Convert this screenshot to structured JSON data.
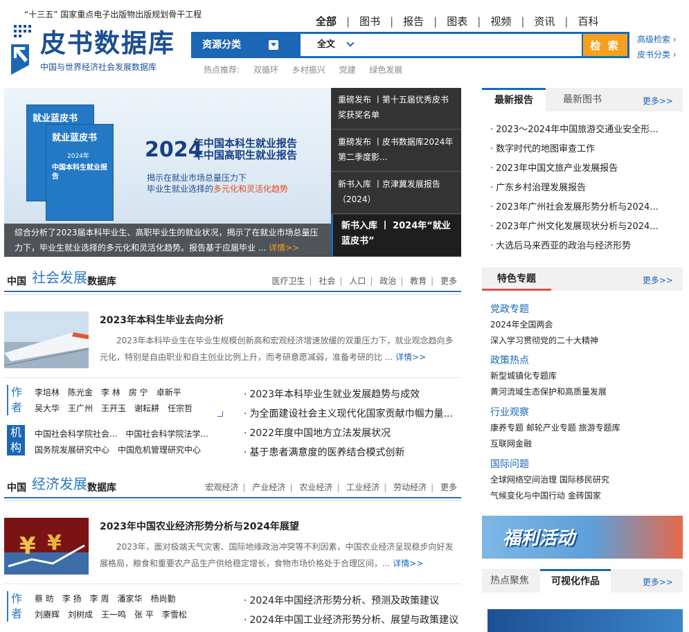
{
  "header": {
    "tagline": "“十三五” 国家重点电子出版物出版规划骨干工程",
    "logo_title": "皮书数据库",
    "logo_sub": "中国与世界经济社会发展数据库",
    "nav": [
      "全部",
      "图书",
      "报告",
      "图表",
      "视频",
      "资讯",
      "百科"
    ],
    "active_nav": "全部"
  },
  "search": {
    "category_label": "资源分类",
    "scope": "全文",
    "placeholder": "",
    "button": "检 索",
    "advanced": "高级检索 ›",
    "classified": "皮书分类 ›",
    "hot_label": "热点推荐:",
    "hot_items": [
      "双循环",
      "乡村振兴",
      "党建",
      "绿色发展"
    ]
  },
  "banner": {
    "book_label": "就业蓝皮书",
    "book_year": "2024年",
    "book_title": "中国本科生就业报告",
    "headline_year": "2024",
    "headline_1": "年中国本科生就业报告",
    "headline_2": "年中国高职生就业报告",
    "sub_1": "揭示在就业市场总量压力下",
    "sub_2": "毕业生就业选择的",
    "sub_2_hl": "多元化和灵活化趋势",
    "caption": "综合分析了2023届本科毕业生、高职毕业生的就业状况，揭示了在就业市场总量压力下，毕业生就业选择的多元化和灵活化趋势。报告基于应届毕业 ...",
    "caption_more": "详情>>",
    "list": [
      {
        "text": "重磅发布 丨第十五届优秀皮书奖获奖名单"
      },
      {
        "text": "重磅发布 丨皮书数据库2024年第二季度影..."
      },
      {
        "text": "新书入库 丨京津冀发展报告（2024）"
      },
      {
        "text": "新书入库 丨 2024年“就业蓝皮书”"
      }
    ]
  },
  "social": {
    "lead": "中国",
    "big": "社会发展",
    "tail": "数据库",
    "cats": [
      "医疗卫生",
      "社会",
      "人口",
      "政治",
      "教育",
      "更多"
    ],
    "feature_title": "2023年本科生毕业去向分析",
    "feature_desc": "2023年本科毕业生在毕业生规模创新高和宏观经济增速放缓的双重压力下，就业观念趋向多元化，特别是自由职业和自主创业比例上升，而考研意愿减弱，准备考研的比 ...",
    "more": "详情>>",
    "author_tag": "作者",
    "authors_1": [
      "李培林",
      "陈光金",
      "李 林",
      "房 宁",
      "卓新平"
    ],
    "authors_2": [
      "吴大华",
      "王广州",
      "王开玉",
      "谢耘耕",
      "任宗哲"
    ],
    "org_tag": "机构",
    "orgs_1": [
      "中国社会科学院社会...",
      "中国社会科学院法学..."
    ],
    "orgs_2": [
      "国务院发展研究中心",
      "中国危机管理研究中心"
    ],
    "related": [
      "2023年本科毕业生就业发展趋势与成效",
      "为全面建设社会主义现代化国家贡献巾帼力量...",
      "2022年度中国地方立法发展状况",
      "基于患者满意度的医养结合模式创新"
    ]
  },
  "economy": {
    "lead": "中国",
    "big": "经济发展",
    "tail": "数据库",
    "cats": [
      "宏观经济",
      "产业经济",
      "农业经济",
      "工业经济",
      "劳动经济",
      "更多"
    ],
    "feature_title": "2023年中国农业经济形势分析与2024年展望",
    "feature_desc": "2023年，面对极端天气灾害、国际地缘政治冲突等不利因素，中国农业经济呈现稳步向好发展格局，粮食和重要农产品生产供给稳定增长，食物市场价格处于合理区间，...",
    "more": "详情>>",
    "author_tag": "作者",
    "authors_1": [
      "蔡 昉",
      "李 扬",
      "李 周",
      "潘家华",
      "杨尚勤"
    ],
    "authors_2": [
      "刘赓辉",
      "刘树成",
      "王一鸣",
      "张 平",
      "李雪松"
    ],
    "related": [
      "2024年中国经济形势分析、预测及政策建议",
      "2024年中国工业经济形势分析、展望与政策建议"
    ]
  },
  "right": {
    "tab_latest_report": "最新报告",
    "tab_latest_book": "最新图书",
    "more": "更多>>",
    "reports": [
      "2023～2024年中国旅游交通业安全形...",
      "数字时代的地图审查工作",
      "2023年中国文旅产业发展报告",
      "广东乡村治理发展报告",
      "2023年广州社会发展形势分析与2024...",
      "2023年广州文化发展现状分析与2024...",
      "大选后马来西亚的政治与经济形势"
    ],
    "feature_tab": "特色专题",
    "topics": [
      {
        "head": "党政专题",
        "items": [
          "2024年全国两会",
          "深入学习贯彻党的二十大精神"
        ]
      },
      {
        "head": "政策热点",
        "items": [
          "新型城镇化专题库",
          "黄河流域生态保护和高质量发展"
        ]
      },
      {
        "head": "行业观察",
        "items": [
          "康养专题 邮轮产业专题 旅游专题库",
          "互联网金融"
        ]
      },
      {
        "head": "国际问题",
        "items": [
          "全球网络空间治理 国际移民研究",
          "气候变化与中国行动 金砖国家"
        ]
      }
    ],
    "welfare": "福利活动",
    "tab_hot": "热点聚焦",
    "tab_visual": "可视化作品"
  },
  "colors": {
    "brand": "#1b67b5",
    "accent": "#f5a01e"
  }
}
